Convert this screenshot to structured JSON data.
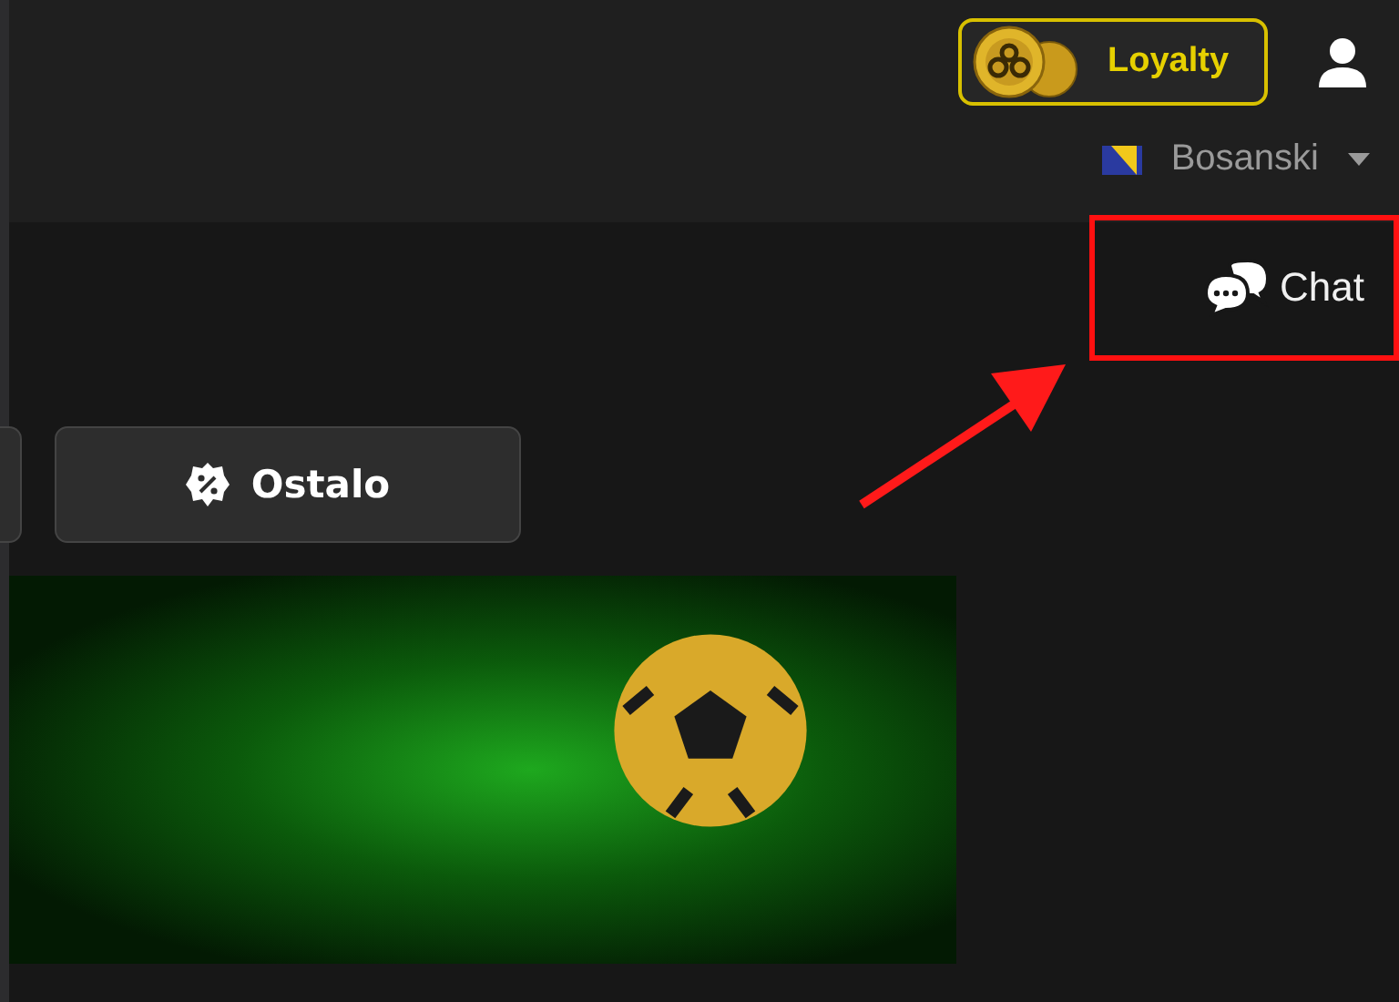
{
  "header": {
    "loyalty_button": {
      "label": "Loyalty"
    },
    "language": {
      "label": "Bosanski"
    }
  },
  "chat": {
    "label": "Chat"
  },
  "category_tabs": [
    {
      "kind": "partial"
    },
    {
      "label": "Ostalo",
      "kind": "full"
    }
  ]
}
